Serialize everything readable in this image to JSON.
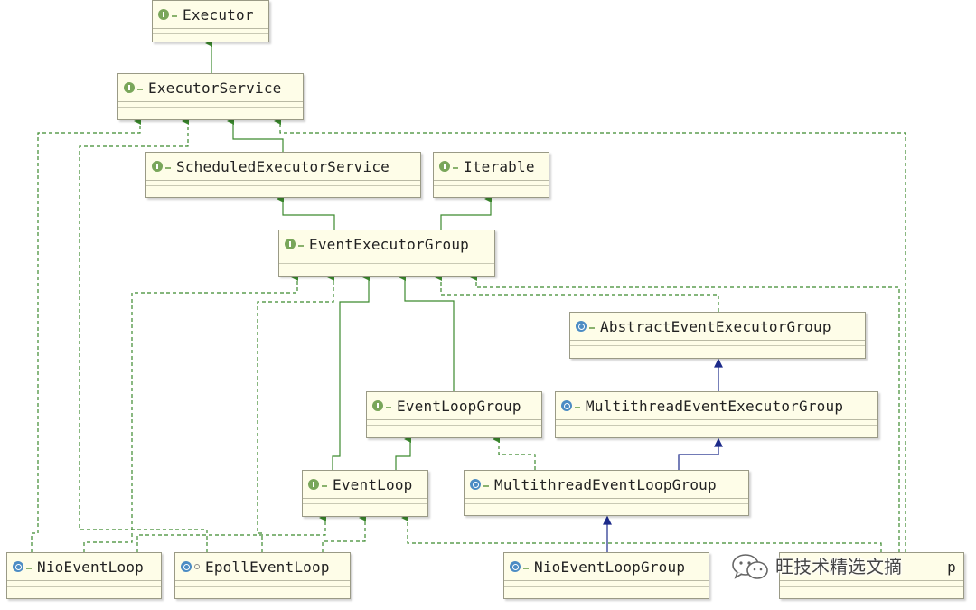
{
  "diagram": {
    "nodes": [
      {
        "id": "executor",
        "label": "Executor",
        "kind": "interface"
      },
      {
        "id": "executorservice",
        "label": "ExecutorService",
        "kind": "interface"
      },
      {
        "id": "scheduled",
        "label": "ScheduledExecutorService",
        "kind": "interface"
      },
      {
        "id": "iterable",
        "label": "Iterable",
        "kind": "interface"
      },
      {
        "id": "eeg",
        "label": "EventExecutorGroup",
        "kind": "interface"
      },
      {
        "id": "aeeg",
        "label": "AbstractEventExecutorGroup",
        "kind": "abstract-class"
      },
      {
        "id": "elg",
        "label": "EventLoopGroup",
        "kind": "interface"
      },
      {
        "id": "meeg",
        "label": "MultithreadEventExecutorGroup",
        "kind": "abstract-class"
      },
      {
        "id": "el",
        "label": "EventLoop",
        "kind": "interface"
      },
      {
        "id": "melg",
        "label": "MultithreadEventLoopGroup",
        "kind": "abstract-class"
      },
      {
        "id": "nioel",
        "label": "NioEventLoop",
        "kind": "class"
      },
      {
        "id": "epollel",
        "label": "EpollEventLoop",
        "kind": "class"
      },
      {
        "id": "nioelg",
        "label": "NioEventLoopGroup",
        "kind": "class"
      },
      {
        "id": "partial",
        "label": "p",
        "kind": "class"
      }
    ],
    "edges": [
      {
        "from": "executorservice",
        "to": "executor",
        "type": "extends"
      },
      {
        "from": "scheduled",
        "to": "executorservice",
        "type": "extends"
      },
      {
        "from": "eeg",
        "to": "scheduled",
        "type": "extends"
      },
      {
        "from": "eeg",
        "to": "iterable",
        "type": "extends"
      },
      {
        "from": "aeeg",
        "to": "eeg",
        "type": "implements"
      },
      {
        "from": "meeg",
        "to": "aeeg",
        "type": "extends-class"
      },
      {
        "from": "elg",
        "to": "eeg",
        "type": "extends"
      },
      {
        "from": "el",
        "to": "eeg",
        "type": "extends"
      },
      {
        "from": "el",
        "to": "elg",
        "type": "extends"
      },
      {
        "from": "melg",
        "to": "meeg",
        "type": "extends-class"
      },
      {
        "from": "melg",
        "to": "elg",
        "type": "implements"
      },
      {
        "from": "nioelg",
        "to": "melg",
        "type": "extends-class"
      },
      {
        "from": "nioel",
        "to": "el",
        "type": "implements"
      },
      {
        "from": "nioel",
        "to": "executorservice",
        "type": "implements"
      },
      {
        "from": "nioel",
        "to": "eeg",
        "type": "implements"
      },
      {
        "from": "epollel",
        "to": "el",
        "type": "implements"
      },
      {
        "from": "epollel",
        "to": "executorservice",
        "type": "implements"
      },
      {
        "from": "epollel",
        "to": "eeg",
        "type": "implements"
      },
      {
        "from": "partial",
        "to": "el",
        "type": "implements"
      },
      {
        "from": "partial",
        "to": "executorservice",
        "type": "implements"
      },
      {
        "from": "partial",
        "to": "eeg",
        "type": "implements"
      }
    ]
  },
  "watermark": {
    "icon": "wechat-icon",
    "text": "旺技术精选文摘"
  },
  "colors": {
    "interface_edge": "#3c8a2e",
    "class_edge": "#1c2a8a",
    "box_fill": "#fefde8"
  }
}
